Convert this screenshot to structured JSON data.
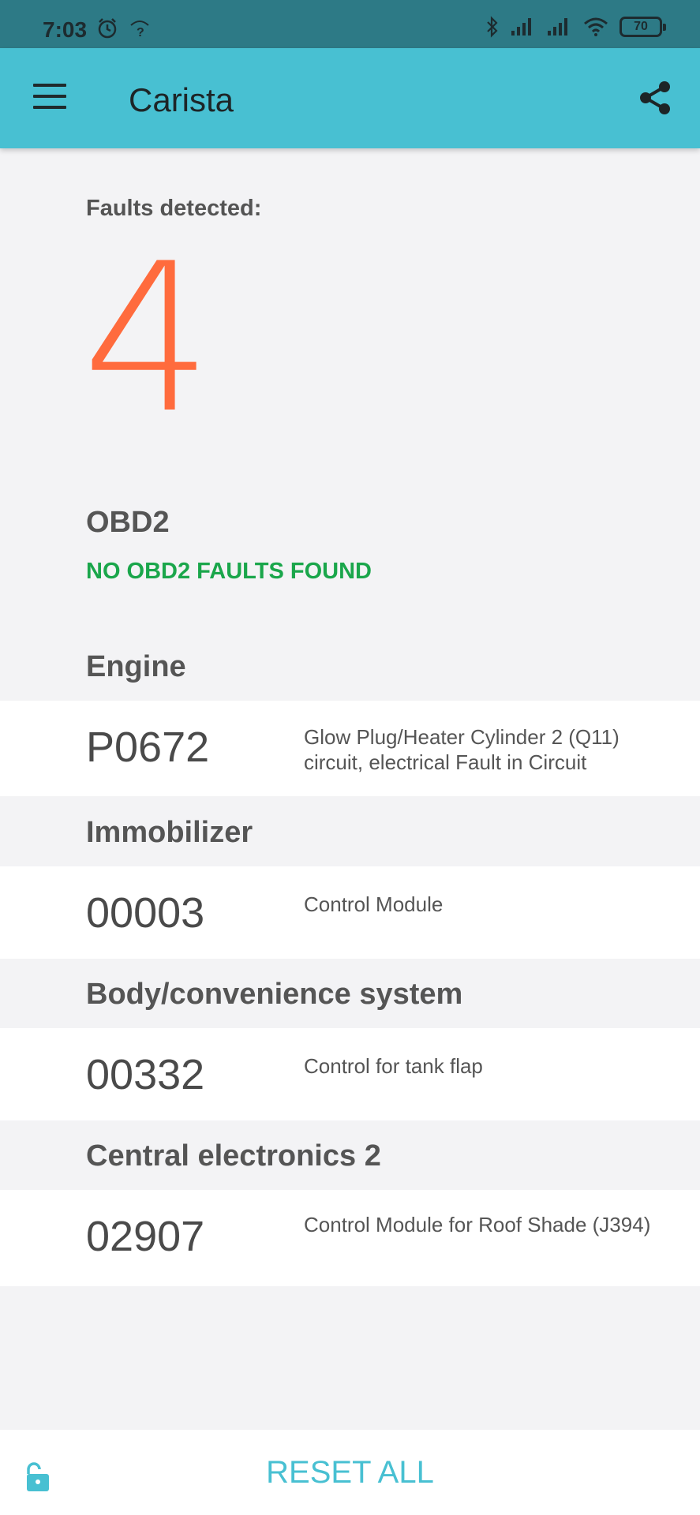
{
  "status_bar": {
    "time": "7:03",
    "battery": "70",
    "icons": [
      "alarm-icon",
      "wifi-question-icon",
      "bluetooth-icon",
      "signal-icon",
      "signal-icon",
      "wifi-icon",
      "battery-icon"
    ]
  },
  "app_bar": {
    "title": "Carista",
    "menu_icon": "menu-icon",
    "share_icon": "share-icon",
    "color": "#48c0d2"
  },
  "summary": {
    "label": "Faults detected:",
    "count": "4",
    "count_color": "#ff6b3d"
  },
  "obd2": {
    "title": "OBD2",
    "status": "NO OBD2 FAULTS FOUND",
    "status_color": "#1aa64b"
  },
  "sections": [
    {
      "title": "Engine",
      "faults": [
        {
          "code": "P0672",
          "description": "Glow Plug/Heater Cylinder 2 (Q11) circuit, electrical Fault in Circuit"
        }
      ]
    },
    {
      "title": "Immobilizer",
      "faults": [
        {
          "code": "00003",
          "description": "Control Module"
        }
      ]
    },
    {
      "title": "Body/convenience system",
      "faults": [
        {
          "code": "00332",
          "description": "Control for tank flap"
        }
      ]
    },
    {
      "title": "Central electronics 2",
      "faults": [
        {
          "code": "02907",
          "description": "Control Module for Roof Shade (J394)"
        }
      ]
    }
  ],
  "bottom_bar": {
    "reset_label": "RESET ALL",
    "lock_icon": "unlock-icon"
  }
}
